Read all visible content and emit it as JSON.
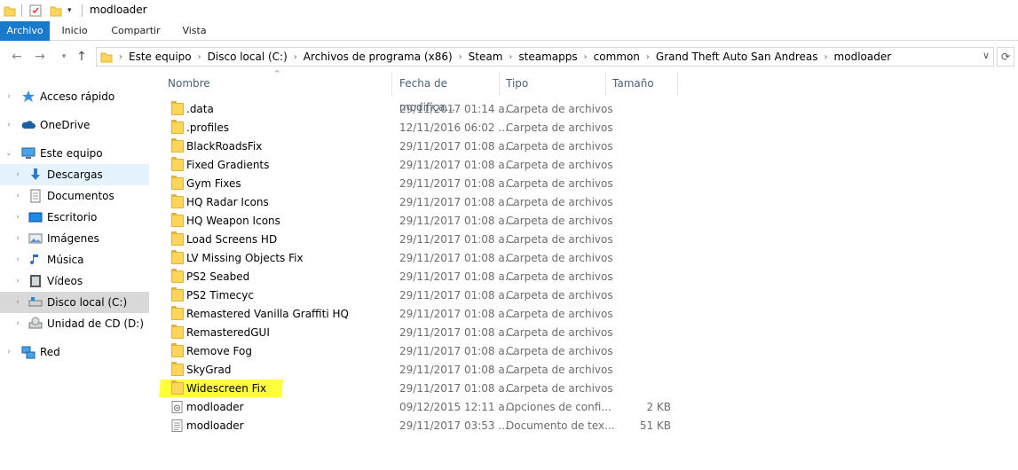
{
  "window": {
    "title": "modloader"
  },
  "ribbon": {
    "tabs": [
      "Archivo",
      "Inicio",
      "Compartir",
      "Vista"
    ]
  },
  "breadcrumb": [
    "Este equipo",
    "Disco local (C:)",
    "Archivos de programa (x86)",
    "Steam",
    "steamapps",
    "common",
    "Grand Theft Auto San Andreas",
    "modloader"
  ],
  "nav": {
    "items": [
      {
        "label": "Acceso rápido",
        "icon": "star-icon"
      },
      {
        "label": "OneDrive",
        "icon": "cloud-icon"
      },
      {
        "label": "Este equipo",
        "icon": "computer-icon"
      },
      {
        "label": "Descargas",
        "icon": "download-icon"
      },
      {
        "label": "Documentos",
        "icon": "documents-icon"
      },
      {
        "label": "Escritorio",
        "icon": "desktop-icon"
      },
      {
        "label": "Imágenes",
        "icon": "pictures-icon"
      },
      {
        "label": "Música",
        "icon": "music-icon"
      },
      {
        "label": "Vídeos",
        "icon": "videos-icon"
      },
      {
        "label": "Disco local (C:)",
        "icon": "drive-icon"
      },
      {
        "label": "Unidad de CD (D:)",
        "icon": "cd-drive-icon"
      },
      {
        "label": "Red",
        "icon": "network-icon"
      }
    ]
  },
  "columns": {
    "name": "Nombre",
    "date": "Fecha de modifica...",
    "type": "Tipo",
    "size": "Tamaño"
  },
  "files": [
    {
      "name": ".data",
      "date": "29/11/2017 01:14 a...",
      "type": "Carpeta de archivos",
      "size": "",
      "kind": "folder"
    },
    {
      "name": ".profiles",
      "date": "12/11/2016 06:02 ...",
      "type": "Carpeta de archivos",
      "size": "",
      "kind": "folder"
    },
    {
      "name": "BlackRoadsFix",
      "date": "29/11/2017 01:08 a...",
      "type": "Carpeta de archivos",
      "size": "",
      "kind": "folder"
    },
    {
      "name": "Fixed Gradients",
      "date": "29/11/2017 01:08 a...",
      "type": "Carpeta de archivos",
      "size": "",
      "kind": "folder"
    },
    {
      "name": "Gym Fixes",
      "date": "29/11/2017 01:08 a...",
      "type": "Carpeta de archivos",
      "size": "",
      "kind": "folder"
    },
    {
      "name": "HQ Radar Icons",
      "date": "29/11/2017 01:08 a...",
      "type": "Carpeta de archivos",
      "size": "",
      "kind": "folder"
    },
    {
      "name": "HQ Weapon Icons",
      "date": "29/11/2017 01:08 a...",
      "type": "Carpeta de archivos",
      "size": "",
      "kind": "folder"
    },
    {
      "name": "Load Screens HD",
      "date": "29/11/2017 01:08 a...",
      "type": "Carpeta de archivos",
      "size": "",
      "kind": "folder"
    },
    {
      "name": "LV Missing Objects Fix",
      "date": "29/11/2017 01:08 a...",
      "type": "Carpeta de archivos",
      "size": "",
      "kind": "folder"
    },
    {
      "name": "PS2 Seabed",
      "date": "29/11/2017 01:08 a...",
      "type": "Carpeta de archivos",
      "size": "",
      "kind": "folder"
    },
    {
      "name": "PS2 Timecyc",
      "date": "29/11/2017 01:08 a...",
      "type": "Carpeta de archivos",
      "size": "",
      "kind": "folder"
    },
    {
      "name": "Remastered Vanilla Graffiti HQ",
      "date": "29/11/2017 01:08 a...",
      "type": "Carpeta de archivos",
      "size": "",
      "kind": "folder"
    },
    {
      "name": "RemasteredGUI",
      "date": "29/11/2017 01:08 a...",
      "type": "Carpeta de archivos",
      "size": "",
      "kind": "folder"
    },
    {
      "name": "Remove Fog",
      "date": "29/11/2017 01:08 a...",
      "type": "Carpeta de archivos",
      "size": "",
      "kind": "folder"
    },
    {
      "name": "SkyGrad",
      "date": "29/11/2017 01:08 a...",
      "type": "Carpeta de archivos",
      "size": "",
      "kind": "folder"
    },
    {
      "name": "Widescreen Fix",
      "date": "29/11/2017 01:08 a...",
      "type": "Carpeta de archivos",
      "size": "",
      "kind": "folder"
    },
    {
      "name": "modloader",
      "date": "09/12/2015 12:11 a...",
      "type": "Opciones de confi...",
      "size": "2 KB",
      "kind": "config"
    },
    {
      "name": "modloader",
      "date": "29/11/2017 03:53 ...",
      "type": "Documento de tex...",
      "size": "51 KB",
      "kind": "text"
    }
  ],
  "colors": {
    "accent": "#1979ca",
    "highlight": "#ffff3a",
    "folder": "#ffd65c"
  }
}
